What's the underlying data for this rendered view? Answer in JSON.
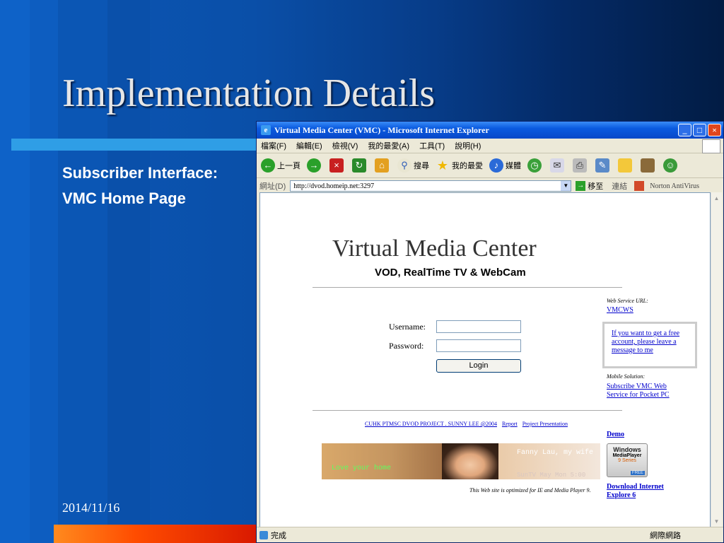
{
  "slide": {
    "title": "Implementation Details",
    "subtitle_line1": "Subscriber Interface:",
    "subtitle_line2": "VMC Home Page",
    "date": "2014/11/16"
  },
  "browser": {
    "window_title": "Virtual Media Center (VMC) - Microsoft Internet Explorer",
    "menu": [
      "檔案(F)",
      "編輯(E)",
      "檢視(V)",
      "我的最愛(A)",
      "工具(T)",
      "說明(H)"
    ],
    "toolbar": {
      "back": "上一頁",
      "search": "搜尋",
      "favorites": "我的最愛",
      "media": "媒體"
    },
    "address_label": "網址(D)",
    "address_value": "http://dvod.homeip.net:3297",
    "go_label": "移至",
    "links_label": "連結",
    "norton": "Norton AntiVirus",
    "status_text": "完成",
    "zone_text": "網際網路"
  },
  "page": {
    "heading": "Virtual Media Center",
    "subheading": "VOD, RealTime TV & WebCam",
    "username_label": "Username:",
    "password_label": "Password:",
    "login_button": "Login",
    "footer_link1": "CUHK PTMSC DVOD PROJECT . SUNNY LEE @2004",
    "footer_link2": "Report",
    "footer_link3": "Project Presentation",
    "banner_love": "Love your home",
    "banner_fanny": "Fanny Lau, my wife",
    "banner_suntv": "SunTV May Mon 5:00",
    "optimized": "This Web site is optimized for IE and Media Player 9.",
    "ws_label": "Web Service URL:",
    "ws_link": "VMCWS",
    "free_account": "If you want to get a free account, please leave a message to me",
    "mobile_label": "Mobile Solution:",
    "mobile_link": "Subscribe VMC Web Service for Pocket PC",
    "demo": "Demo",
    "wmp_line1": "Windows",
    "wmp_line2": "MediaPlayer",
    "wmp_line3": "9 Series",
    "wmp_free": "FREE",
    "download": "Download Internet Explore 6"
  },
  "colors": {
    "slide_bg": "#0a4fa8",
    "accent_bar": "#2f9ee6",
    "orange_bar": "#ff4c00",
    "xp_title": "#0a5ae0",
    "link": "#0000cc"
  }
}
